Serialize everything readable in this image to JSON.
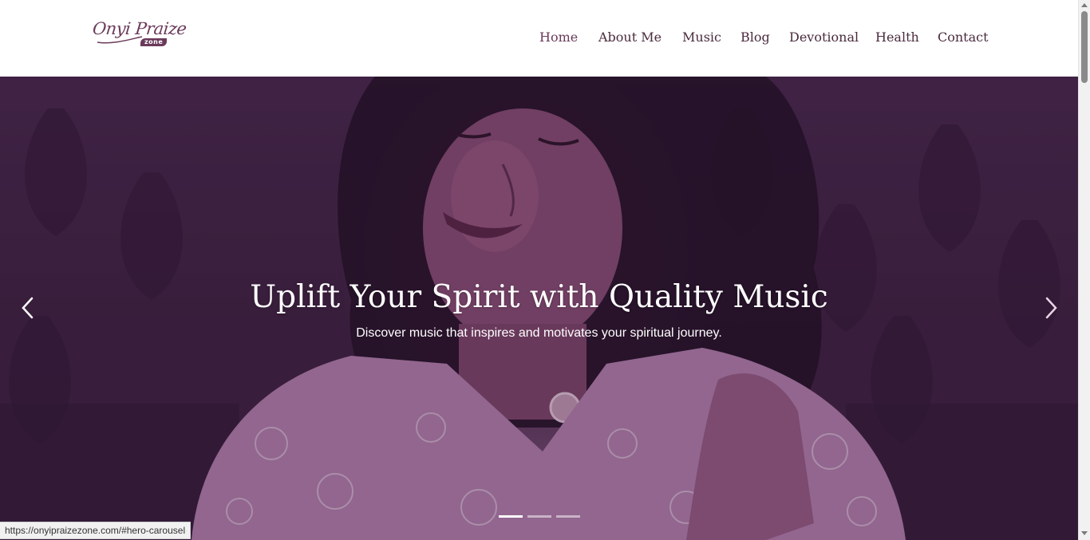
{
  "site": {
    "logo": {
      "script_text": "Onyi Praize",
      "badge_text": "zone",
      "color": "#6b3a5a"
    }
  },
  "nav": {
    "items": [
      {
        "label": "Home",
        "active": true
      },
      {
        "label": "About Me"
      },
      {
        "label": "Music"
      },
      {
        "label": "Blog"
      },
      {
        "label": "Devotional"
      },
      {
        "label": "Health"
      },
      {
        "label": "Contact"
      }
    ]
  },
  "hero": {
    "title": "Uplift Your Spirit with Quality Music",
    "subtitle": "Discover music that inspires and motivates your spiritual journey.",
    "prev_icon": "chevron-left-icon",
    "next_icon": "chevron-right-icon",
    "slides_count": 3,
    "active_slide": 1,
    "overlay_color": "#3b213d"
  },
  "status_bar": {
    "url": "https://onyipraizezone.com/#hero-carousel"
  },
  "colors": {
    "brand": "#6b3a5a",
    "nav_text": "#4a2b3d"
  }
}
